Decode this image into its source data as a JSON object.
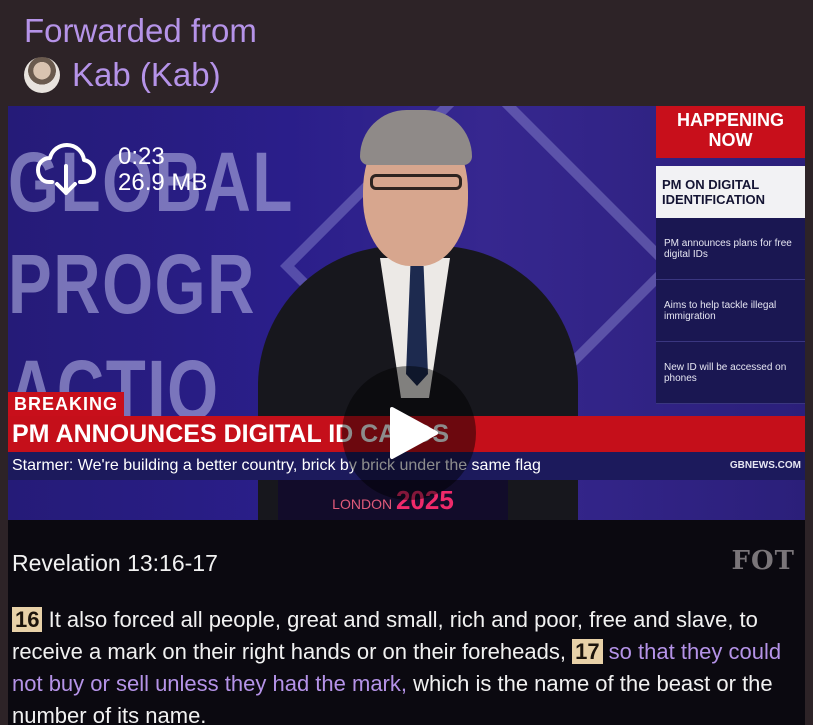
{
  "forward": {
    "label": "Forwarded from",
    "author": "Kab (Kab)"
  },
  "video": {
    "duration": "0:23",
    "size": "26.9 MB",
    "icons": {
      "download": "cloud-download-icon",
      "play": "play-icon"
    },
    "overlay": {
      "stage_words": [
        "GLOBAL",
        "PROGR",
        "ACTIO"
      ],
      "ticker": {
        "happening": "HAPPENING NOW",
        "topic": "PM ON DIGITAL IDENTIFICATION",
        "items": [
          "PM announces plans for free digital IDs",
          "Aims to help tackle illegal immigration",
          "New ID will be accessed on phones"
        ]
      },
      "breaking": "BREAKING",
      "headline": "PM ANNOUNCES DIGITAL ID CARDS",
      "strap": "Starmer: We're building a better country, brick by brick under the same flag",
      "source": "GBNEWS.COM",
      "podium_city": "LONDON",
      "podium_year": "2025"
    },
    "caption": {
      "reference": "Revelation 13:16-17",
      "brand": "FOT",
      "verse16_num": "16",
      "verse16_text": " It also forced all people, great and small, rich and poor, free and slave, to receive a mark on their right hands or on their foreheads, ",
      "verse17_num": "17",
      "verse17_highlight": " so that they could not buy or sell unless they had the mark,",
      "verse17_text": " which is the name of the beast or the number of its name."
    }
  },
  "colors": {
    "accent": "#b593e8",
    "bubble_bg": "#2d2327",
    "news_red": "#c80f1b",
    "news_navy": "#1c1a5c"
  }
}
